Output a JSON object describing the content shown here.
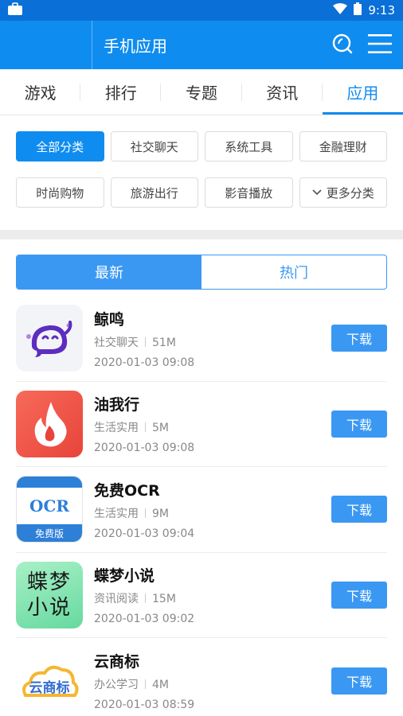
{
  "status": {
    "time": "9:13"
  },
  "header": {
    "title": "手机应用"
  },
  "tabs": [
    {
      "label": "游戏"
    },
    {
      "label": "排行"
    },
    {
      "label": "专题"
    },
    {
      "label": "资讯"
    },
    {
      "label": "应用"
    }
  ],
  "categories": [
    {
      "label": "全部分类"
    },
    {
      "label": "社交聊天"
    },
    {
      "label": "系统工具"
    },
    {
      "label": "金融理财"
    },
    {
      "label": "时尚购物"
    },
    {
      "label": "旅游出行"
    },
    {
      "label": "影音播放"
    },
    {
      "label": "更多分类"
    }
  ],
  "sort": {
    "newest": "最新",
    "hot": "热门"
  },
  "apps": [
    {
      "name": "鲸鸣",
      "category": "社交聊天",
      "size": "51M",
      "date": "2020-01-03 09:08",
      "download": "下载"
    },
    {
      "name": "油我行",
      "category": "生活实用",
      "size": "5M",
      "date": "2020-01-03 09:08",
      "download": "下载"
    },
    {
      "name": "免费OCR",
      "category": "生活实用",
      "size": "9M",
      "date": "2020-01-03 09:04",
      "download": "下载",
      "icon_text": "OCR",
      "icon_sub": "免费版"
    },
    {
      "name": "蝶梦小说",
      "category": "资讯阅读",
      "size": "15M",
      "date": "2020-01-03 09:02",
      "download": "下载",
      "icon_text": "蝶梦小说"
    },
    {
      "name": "云商标",
      "category": "办公学习",
      "size": "4M",
      "date": "2020-01-03 08:59",
      "download": "下载",
      "icon_text": "云商标"
    }
  ],
  "colors": {
    "primary": "#0f8cf0",
    "accent": "#3a98f3",
    "statusbar": "#0a6fd6"
  }
}
